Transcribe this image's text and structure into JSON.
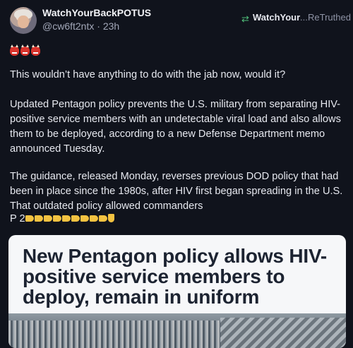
{
  "post": {
    "display_name": "WatchYourBackPOTUS",
    "handle": "@cw6ft2ntx",
    "time": "23h",
    "retruthed_by": "WatchYour",
    "ellipsis": "...",
    "retruthed_label": "ReTruthed",
    "emojis": [
      "ogre",
      "ogre",
      "ogre"
    ],
    "paragraphs": [
      "This wouldn’t have anything to do with the jab now, would it?",
      "Updated Pentagon policy prevents the U.S. military from separating HIV-positive service members with an undetectable viral load and also allows them to be deployed, according to a new Defense Department memo announced Tuesday.",
      "The guidance, released Monday, reverses previous DOD policy that had been in place since the 1980s, after HIV first began spreading in the U.S. That outdated policy allowed commanders",
      "P 2"
    ],
    "pointing_emojis": [
      "point-left",
      "point-left",
      "point-left",
      "point-left",
      "point-left",
      "point-left",
      "point-left",
      "point-left",
      "point-left",
      "point-down"
    ]
  },
  "card": {
    "headline": "New Pentagon policy allows HIV-positive service members to deploy, remain in uniform"
  },
  "colors": {
    "background": "#10131c",
    "text": "#e6e8ef",
    "muted": "#a2a7b8",
    "retruth_green": "#4fbf7a"
  }
}
